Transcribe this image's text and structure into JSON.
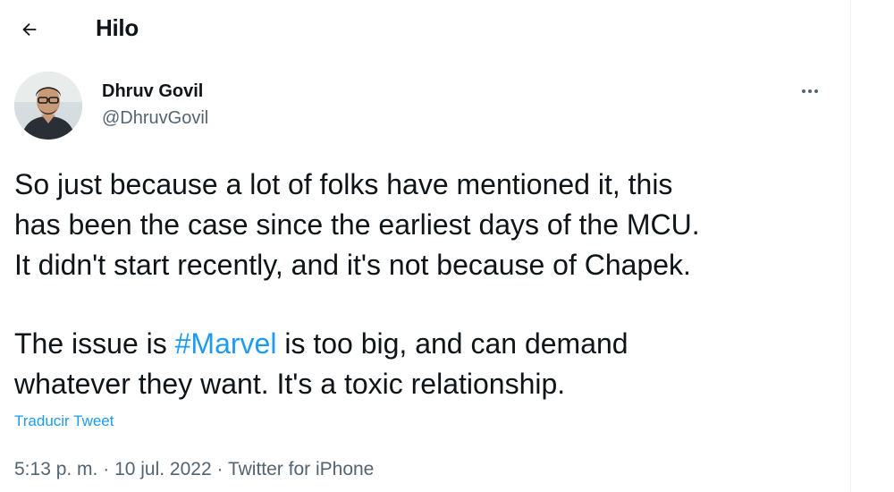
{
  "header": {
    "back_icon": "arrow-left-icon",
    "title": "Hilo"
  },
  "tweet": {
    "author": {
      "name": "Dhruv Govil",
      "handle": "@DhruvGovil"
    },
    "more_icon": "more-horizontal-icon",
    "paragraph1": [
      "So just because a lot of folks have mentioned it, this",
      "has been the case since the earliest days of the MCU.",
      "It didn't start recently, and it's not because of Chapek."
    ],
    "paragraph2": {
      "line1_before": "The issue is ",
      "hashtag": "#Marvel",
      "line1_after": " is too big, and can demand",
      "line2": "whatever they want. It's a toxic relationship."
    },
    "translate_label": "Traducir Tweet",
    "time": "5:13 p. m.",
    "date": "10 jul. 2022",
    "source": "Twitter for iPhone",
    "separator": " · "
  },
  "colors": {
    "accent": "#1d9bf0",
    "text": "#0f1419",
    "secondary": "#536471"
  }
}
